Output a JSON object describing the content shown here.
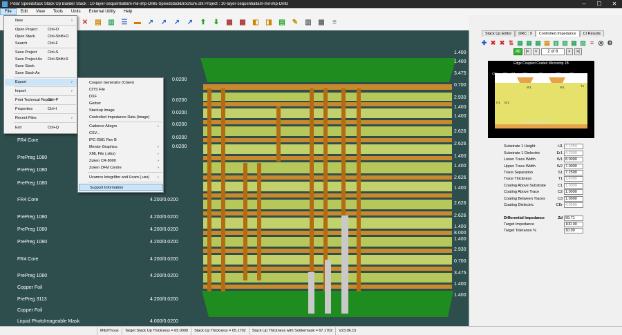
{
  "window": {
    "title": "Polar Speedstack Stack Up Builder   Stack : 10-layer-sequentiallam-mil-imp-Drills-SpeedstackBrochure.stk   Project : 10-layer-sequentiallam-mil-imp-Drills",
    "minimize": "–",
    "maximize": "☐",
    "close": "✕"
  },
  "menubar": [
    "File",
    "Edit",
    "View",
    "Tools",
    "Units",
    "External Utility",
    "Help"
  ],
  "file_menu": {
    "items": [
      {
        "label": "New",
        "shortcut": "",
        "submenu": true
      },
      {
        "label": "Open Project",
        "shortcut": "Ctrl+O"
      },
      {
        "label": "Open Stack",
        "shortcut": "Ctrl+Shift+O"
      },
      {
        "label": "Search",
        "shortcut": "Ctrl+F"
      },
      {
        "label": "Save Project",
        "shortcut": "Ctrl+S"
      },
      {
        "label": "Save Project As",
        "shortcut": "Ctrl+Shift+S"
      },
      {
        "label": "Save Stack",
        "shortcut": ""
      },
      {
        "label": "Save Stack As",
        "shortcut": ""
      },
      {
        "label": "Export",
        "shortcut": "",
        "submenu": true
      },
      {
        "label": "Import",
        "shortcut": "",
        "submenu": true
      },
      {
        "label": "Print Technical Report",
        "shortcut": "Ctrl+P"
      },
      {
        "label": "Properties",
        "shortcut": "Ctrl+I"
      },
      {
        "label": "Recent Files",
        "shortcut": "",
        "submenu": true
      },
      {
        "label": "Exit",
        "shortcut": "Ctrl+Q"
      }
    ]
  },
  "export_menu": {
    "items": [
      {
        "label": "Coupon Generator (CGen)"
      },
      {
        "label": "CITS File"
      },
      {
        "label": "DXF"
      },
      {
        "label": "Gerber"
      },
      {
        "label": "Stackup Image"
      },
      {
        "label": "Controlled Impedance Data (Image)"
      },
      {
        "label": "Cadence Allegro",
        "submenu": true
      },
      {
        "label": "CSV..."
      },
      {
        "label": "IPC-2581 Rev B"
      },
      {
        "label": "Mentor Graphics",
        "submenu": true
      },
      {
        "label": "XML File (.stkx)",
        "submenu": true
      },
      {
        "label": "Zuken CR-8000",
        "submenu": true
      },
      {
        "label": "Zuken DFM Centre",
        "submenu": true
      },
      {
        "label": "Ucamco Integr8tor and Ucam (.usx)",
        "submenu": true
      },
      {
        "label": "Support Information"
      }
    ]
  },
  "stack_left": {
    "labels": [
      "FR4 Core",
      "PrePreg 1080",
      "PrePreg 1080",
      "PrePreg 1080",
      "FR4 Core",
      "PrePreg 1080",
      "PrePreg 1080",
      "PrePreg 1080",
      "FR4 Core",
      "PrePreg 1080",
      "Copper Foil",
      "PrePreg 3113",
      "Copper Foil",
      "Liquid PhotoImageable Mask"
    ],
    "mid_values": [
      "4.200/0.0200",
      "4.200/0.0200",
      "4.200/0.0200",
      "4.200/0.0200",
      "4.200/0.0200",
      "4.200/0.0200",
      "4.200/0.0200",
      "4.200/0.0200",
      "4.200/0.0200",
      "4.200/0.0200",
      "4.000/0.0200"
    ],
    "partial_values": [
      "0.0200",
      "0.0200",
      "0.0200",
      "0.0200",
      "0.0200",
      "0.0200"
    ]
  },
  "stack_right_values": [
    "1.400",
    "1.400",
    "3.475",
    "0.700",
    "2.930",
    "1.400",
    "1.400",
    "2.626",
    "2.626",
    "1.400",
    "1.400",
    "2.626",
    "1.400",
    "2.626",
    "2.626",
    "1.400",
    "8.000",
    "1.400",
    "2.930",
    "0.700",
    "3.475",
    "1.400",
    "1.400"
  ],
  "right_panel": {
    "tabs": [
      "Stack Up Editor",
      "DRC : 9",
      "Controlled Impedance",
      "CI Results"
    ],
    "active_tab": "Controlled Impedance",
    "nav": {
      "all": "All",
      "first": "|<",
      "prev": "<",
      "page": "2 of 8",
      "next": ">",
      "last": ">|"
    },
    "diagram": {
      "title": "Edge Coupled Coated Microstrip 1B",
      "url": "polarinstruments.com",
      "labels": [
        "CEr",
        "C2",
        "C1",
        "W2",
        "S1",
        "W2",
        "C3",
        "H1",
        "Er1",
        "W1",
        "T1",
        "W1"
      ]
    },
    "params": [
      {
        "label": "Substrate 1 Height",
        "sym": "H1",
        "value": "7.1050",
        "grey": true
      },
      {
        "label": "Substrate 1 Dielectric",
        "sym": "Er1",
        "value": "4.2000",
        "grey": true
      },
      {
        "label": "Lower Trace Width",
        "sym": "W1",
        "value": "8.0000",
        "grey": false
      },
      {
        "label": "Upper Trace Width",
        "sym": "W2",
        "value": "7.0000",
        "grey": false
      },
      {
        "label": "Trace Separation",
        "sym": "S1",
        "value": "7.2500",
        "grey": false
      },
      {
        "label": "Trace Thickness",
        "sym": "T1",
        "value": "1.4000",
        "grey": true
      },
      {
        "label": "Coating Above Substrate",
        "sym": "C1",
        "value": "1.0000",
        "grey": true
      },
      {
        "label": "Coating Above Trace",
        "sym": "C2",
        "value": "1.0000",
        "grey": false
      },
      {
        "label": "Coating Between Traces",
        "sym": "C3",
        "value": "1.0000",
        "grey": false
      },
      {
        "label": "Coating Dielectric",
        "sym": "CEr",
        "value": "4.0000",
        "grey": true
      }
    ],
    "results": [
      {
        "label": "Differential Impedance",
        "sym": "Zd",
        "value": "99.71",
        "bold": true
      },
      {
        "label": "Target Impedance",
        "sym": "",
        "value": "100.00"
      },
      {
        "label": "Target Tolerance %",
        "sym": "",
        "value": "10.00"
      }
    ]
  },
  "statusbar": {
    "units": "Mils/Thous",
    "target": "Target Stack Up Thickness = 65.0000",
    "thickness": "Stack Up Thickness = 65.1702",
    "soldermask": "Stack Up Thickness with Soldermask = 67.1702",
    "version": "V23.06.15"
  },
  "colors": {
    "viewport": "#2e4d4d",
    "copper": "#c98a2e",
    "dielectric": "#b7c85a",
    "mask": "#1f8c1f"
  }
}
